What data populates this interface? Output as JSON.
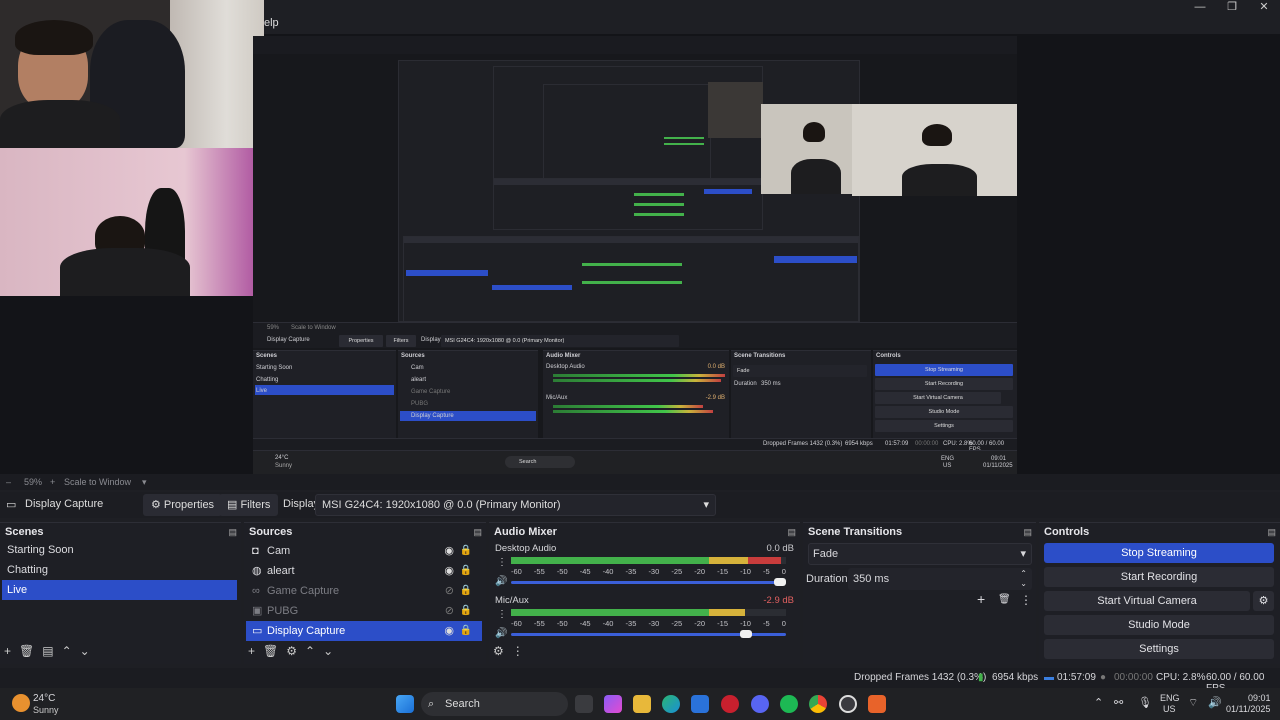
{
  "window": {
    "menu_help": "elp"
  },
  "preview": {
    "inner": {
      "source_label": "Display Capture",
      "properties": "Properties",
      "filters": "Filters",
      "display_label": "Display",
      "display_value": "MSI G24C4: 1920x1080 @ 0.0 (Primary Monitor)",
      "zoom": "59%",
      "scale": "Scale to Window",
      "scenes_title": "Scenes",
      "scenes": [
        "Starting Soon",
        "Chatting",
        "Live"
      ],
      "sources_title": "Sources",
      "sources": [
        "Cam",
        "aleart",
        "Game Capture",
        "PUBG",
        "Display Capture"
      ],
      "audio_title": "Audio Mixer",
      "desktop_audio": "Desktop Audio",
      "desktop_db": "0.0 dB",
      "mic": "Mic/Aux",
      "mic_db": "-2.9 dB",
      "transitions_title": "Scene Transitions",
      "fade": "Fade",
      "duration_label": "Duration",
      "duration_value": "350 ms",
      "controls_title": "Controls",
      "controls": [
        "Stop Streaming",
        "Start Recording",
        "Start Virtual Camera",
        "Studio Mode",
        "Settings"
      ],
      "dropped": "Dropped Frames 1432 (0.3%)",
      "kbps": "6954 kbps",
      "time": "01:57:09",
      "rec": "00:00:00",
      "cpu": "CPU: 2.8%",
      "fps": "60.00 / 60.00 FPS",
      "weather_temp": "24°C",
      "weather": "Sunny",
      "search": "Search",
      "clock": "09:01",
      "date": "01/11/2025",
      "lang1": "ENG",
      "lang2": "US"
    }
  },
  "zoombar": {
    "zoom": "59%",
    "scale": "Scale to Window"
  },
  "source_toolbar": {
    "source_name": "Display Capture",
    "properties": "Properties",
    "filters": "Filters",
    "display_label": "Display",
    "display_value": "MSI G24C4: 1920x1080 @ 0.0 (Primary Monitor)"
  },
  "scenes": {
    "title": "Scenes",
    "items": [
      "Starting Soon",
      "Chatting",
      "Live"
    ],
    "selected": "Live"
  },
  "sources": {
    "title": "Sources",
    "items": [
      {
        "name": "Cam",
        "icon": "camera-icon",
        "visible": true
      },
      {
        "name": "aleart",
        "icon": "globe-icon",
        "visible": true
      },
      {
        "name": "Game Capture",
        "icon": "gamepad-icon",
        "visible": false
      },
      {
        "name": "PUBG",
        "icon": "media-icon",
        "visible": false
      },
      {
        "name": "Display Capture",
        "icon": "monitor-icon",
        "visible": true
      }
    ]
  },
  "audio": {
    "title": "Audio Mixer",
    "ticks": [
      "-60",
      "-55",
      "-50",
      "-45",
      "-40",
      "-35",
      "-30",
      "-25",
      "-20",
      "-15",
      "-10",
      "-5",
      "0"
    ],
    "channels": [
      {
        "name": "Desktop Audio",
        "db": "0.0 dB",
        "level": 0.98,
        "volume": 1.0
      },
      {
        "name": "Mic/Aux",
        "db": "-2.9 dB",
        "level": 0.85,
        "volume": 0.87
      }
    ]
  },
  "transitions": {
    "title": "Scene Transitions",
    "type": "Fade",
    "duration_label": "Duration",
    "duration_value": "350 ms"
  },
  "controls": {
    "title": "Controls",
    "stop_streaming": "Stop Streaming",
    "start_recording": "Start Recording",
    "start_virtual_camera": "Start Virtual Camera",
    "studio_mode": "Studio Mode",
    "settings": "Settings"
  },
  "status": {
    "dropped": "Dropped Frames 1432 (0.3%)",
    "kbps": "6954 kbps",
    "stream_time": "01:57:09",
    "rec_time": "00:00:00",
    "cpu": "CPU: 2.8%",
    "fps": "60.00 / 60.00 FPS"
  },
  "taskbar": {
    "weather_temp": "24°C",
    "weather_desc": "Sunny",
    "search": "Search",
    "lang1": "ENG",
    "lang2": "US",
    "time": "09:01",
    "date": "01/11/2025"
  },
  "colors": {
    "accent": "#2c4ec8",
    "meter_green": "#43b14b",
    "meter_yellow": "#d6b23b",
    "meter_red": "#c83c3c"
  }
}
